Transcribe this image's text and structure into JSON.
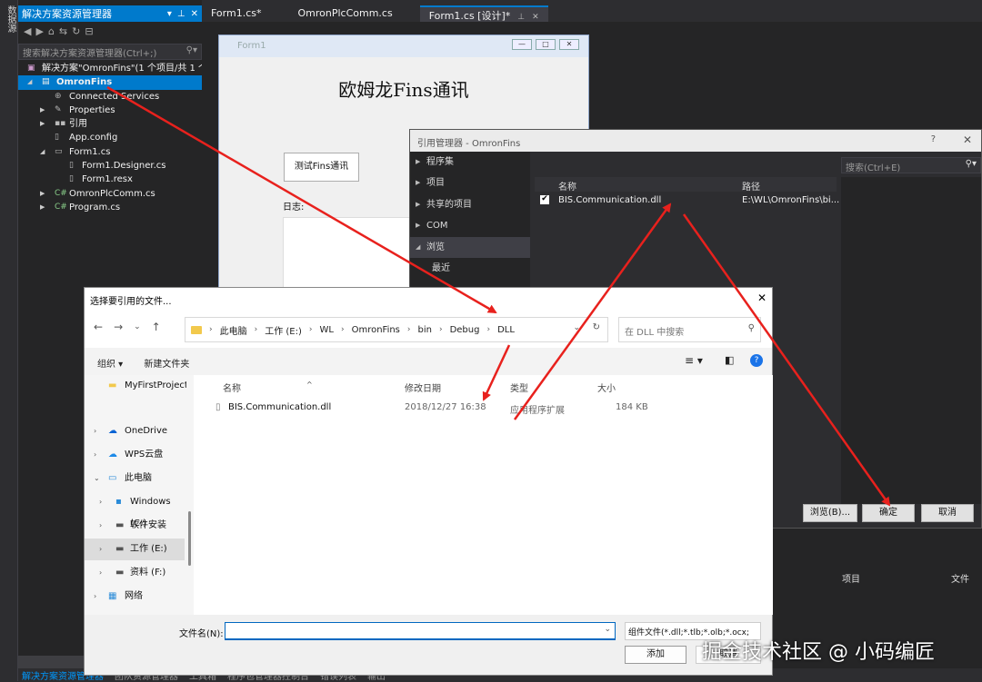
{
  "left_strip": {
    "label": "数据源"
  },
  "solution_explorer": {
    "title": "解决方案资源管理器",
    "search_placeholder": "搜索解决方案资源管理器(Ctrl+;)",
    "items": [
      {
        "label": "解决方案\"OmronFins\"(1 个项目/共 1 个"
      },
      {
        "label": "OmronFins"
      },
      {
        "label": "Connected Services"
      },
      {
        "label": "Properties"
      },
      {
        "label": "引用"
      },
      {
        "label": "App.config"
      },
      {
        "label": "Form1.cs"
      },
      {
        "label": "Form1.Designer.cs"
      },
      {
        "label": "Form1.resx"
      },
      {
        "label": "OmronPlcComm.cs"
      },
      {
        "label": "Program.cs"
      }
    ]
  },
  "bottom_tabs": [
    "解决方案资源管理器",
    "团队资源管理器",
    "工具箱",
    "程序包管理器控制台",
    "错误列表",
    "输出"
  ],
  "doc_tabs": [
    {
      "label": "Form1.cs*"
    },
    {
      "label": "OmronPlcComm.cs"
    },
    {
      "label": "Form1.cs [设计]*"
    }
  ],
  "form1": {
    "title": "Form1",
    "heading": "欧姆龙Fins通讯",
    "button": "测试Fins通讯",
    "log_label": "日志:"
  },
  "reference_manager": {
    "title": "引用管理器 - OmronFins",
    "help": "?",
    "nav": [
      "程序集",
      "项目",
      "共享的项目",
      "COM",
      "浏览",
      "最近"
    ],
    "columns": {
      "name": "名称",
      "path": "路径"
    },
    "rows": [
      {
        "name": "BIS.Communication.dll",
        "path": "E:\\WL\\OmronFins\\bi..."
      }
    ],
    "search_placeholder": "搜索(Ctrl+E)",
    "buttons": {
      "browse": "浏览(B)...",
      "ok": "确定",
      "cancel": "取消"
    },
    "bottom_headers": {
      "project": "项目",
      "file": "文件"
    }
  },
  "file_dialog": {
    "title": "选择要引用的文件...",
    "path": [
      "此电脑",
      "工作 (E:)",
      "WL",
      "OmronFins",
      "bin",
      "Debug",
      "DLL"
    ],
    "search_placeholder": "在 DLL 中搜索",
    "toolbar": {
      "organize": "组织 ▾",
      "new_folder": "新建文件夹"
    },
    "sidebar": [
      {
        "label": "MyFirstProject"
      },
      {
        "label": "OneDrive"
      },
      {
        "label": "WPS云盘"
      },
      {
        "label": "此电脑"
      },
      {
        "label": "Windows (C:)"
      },
      {
        "label": "软件安装 (D:)"
      },
      {
        "label": "工作 (E:)"
      },
      {
        "label": "资料 (F:)"
      },
      {
        "label": "网络"
      }
    ],
    "columns": {
      "name": "名称",
      "date": "修改日期",
      "type": "类型",
      "size": "大小"
    },
    "files": [
      {
        "name": "BIS.Communication.dll",
        "date": "2018/12/27 16:38",
        "type": "应用程序扩展",
        "size": "184 KB"
      }
    ],
    "filename_label": "文件名(N):",
    "filename_value": "",
    "filetype": "组件文件(*.dll;*.tlb;*.olb;*.ocx;",
    "add": "添加",
    "cancel": "取消"
  },
  "watermark": "掘金技术社区 @ 小码编匠",
  "colors": {
    "accent": "#007acc",
    "arrow": "#e8211d",
    "vs_bg": "#2d2d30"
  }
}
